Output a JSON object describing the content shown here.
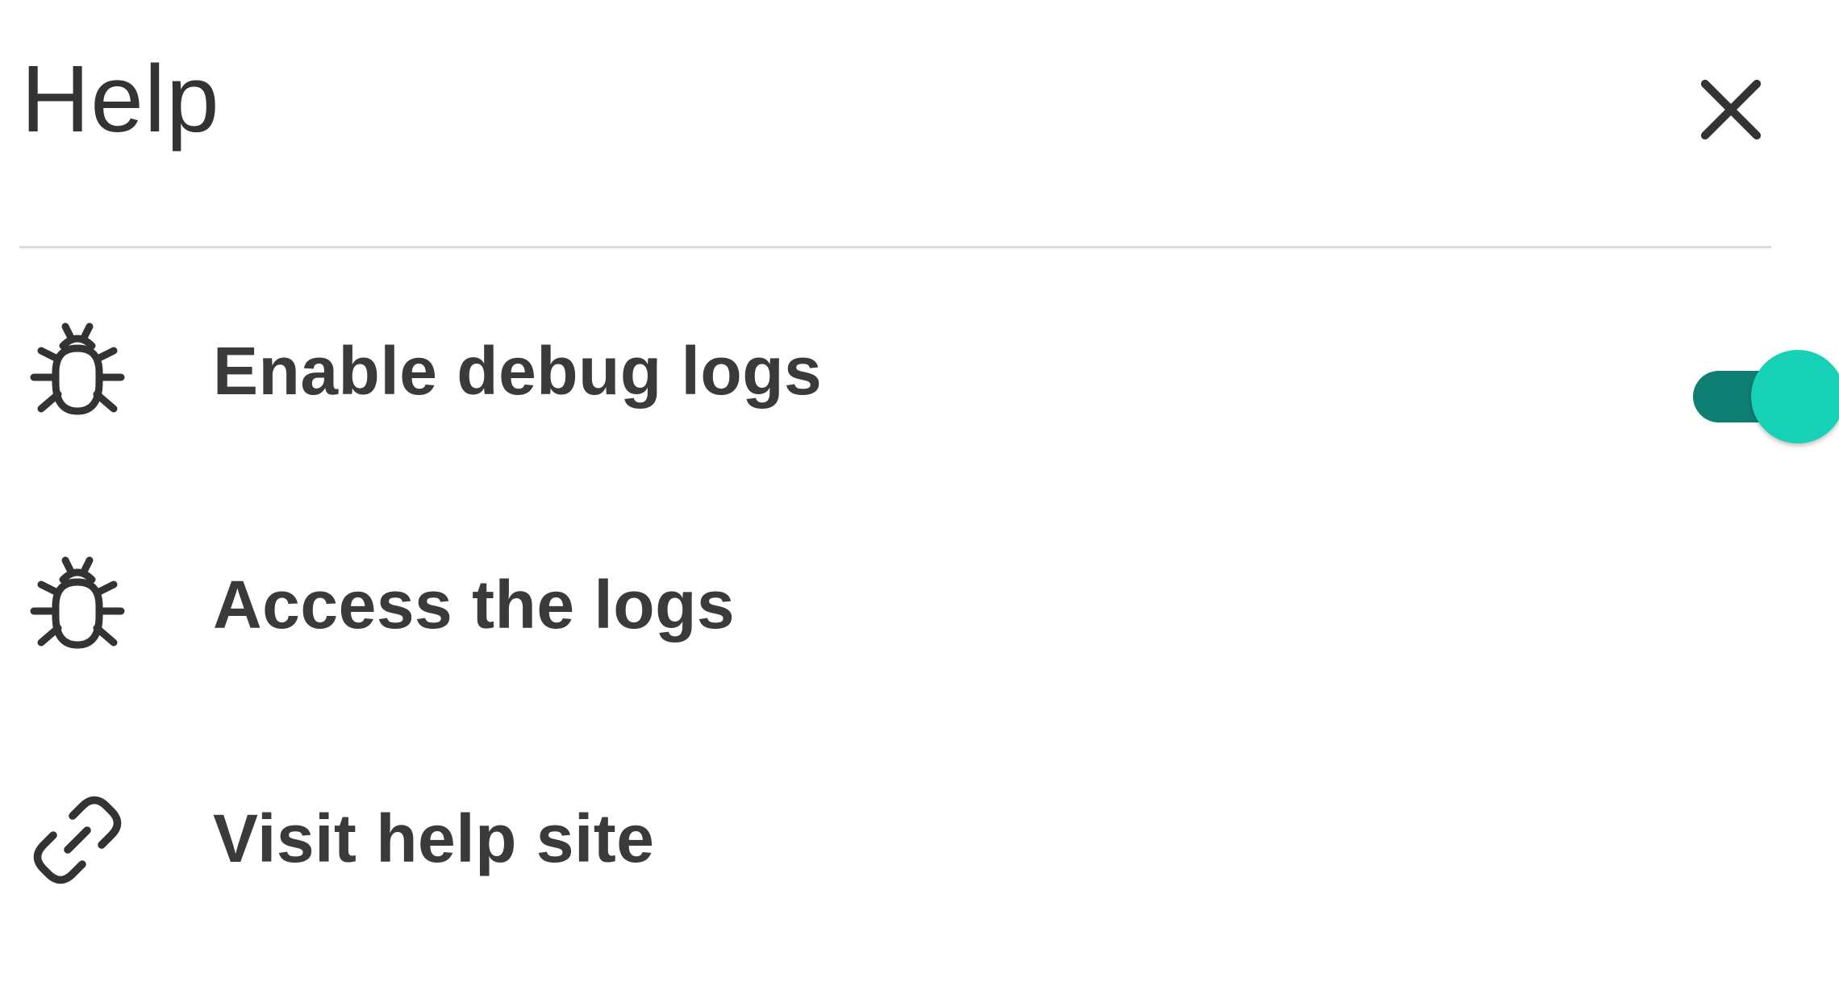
{
  "dialog": {
    "title": "Help",
    "close_icon": "close-icon"
  },
  "items": [
    {
      "label": "Enable debug logs",
      "icon": "bug-icon",
      "toggle": {
        "on": true
      }
    },
    {
      "label": "Access the logs",
      "icon": "bug-icon"
    },
    {
      "label": "Visit help site",
      "icon": "link-icon"
    }
  ],
  "colors": {
    "toggle_track": "#0f7f73",
    "toggle_thumb": "#16d1b6",
    "text": "#333333",
    "divider": "#dcdcdc"
  }
}
